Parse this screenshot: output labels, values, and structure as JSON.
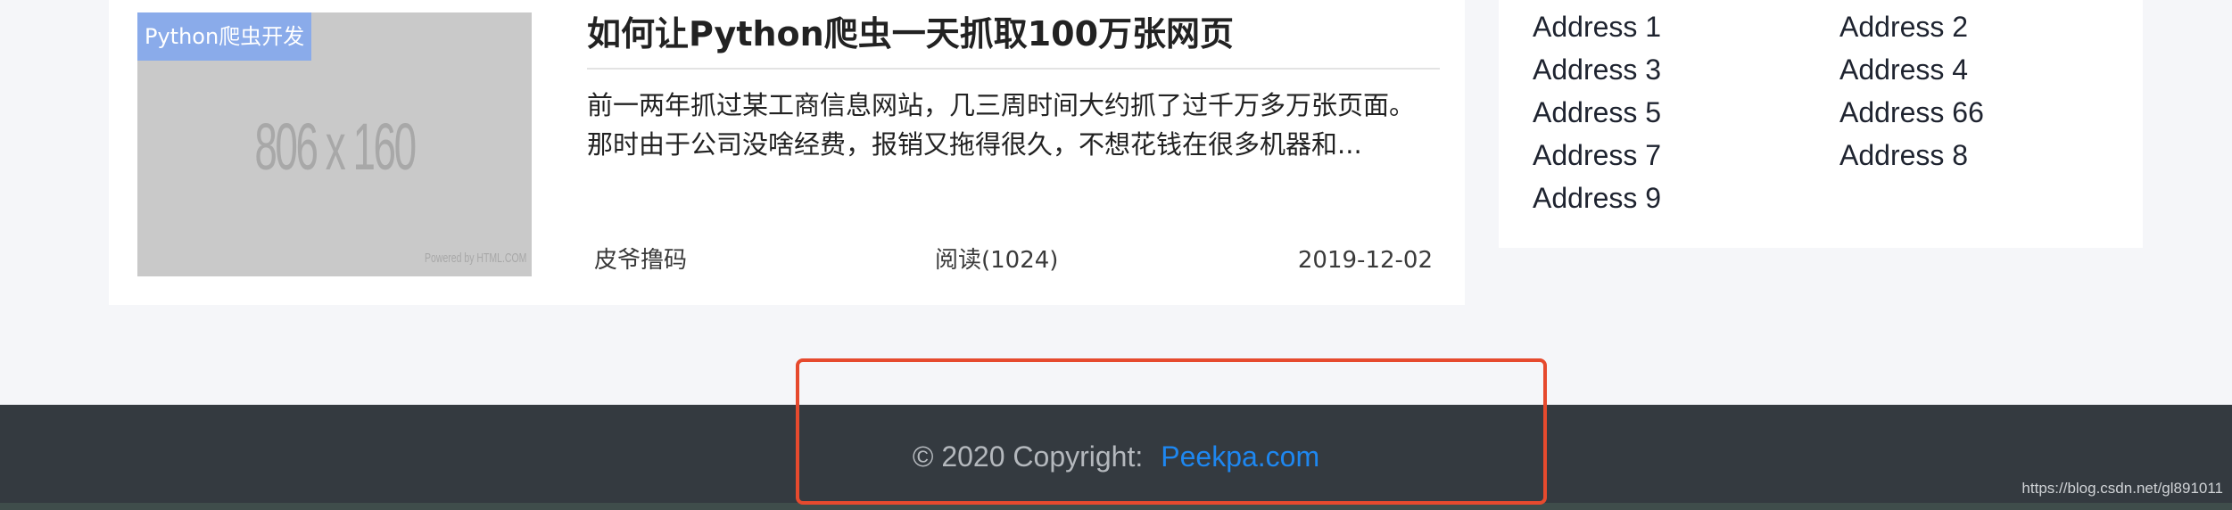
{
  "article": {
    "category_tag": "Python爬虫开发",
    "thumbnail": {
      "size_text": "806 x 160",
      "credit_text": "Powered by HTML.COM"
    },
    "title": "如何让Python爬虫一天抓取100万张网页",
    "excerpt": "前一两年抓过某工商信息网站，几三周时间大约抓了过千万多万张页面。那时由于公司没啥经费，报销又拖得很久，不想花钱在很多机器和...",
    "author": "皮爷撸码",
    "views": "阅读(1024)",
    "date": "2019-12-02"
  },
  "sidebar": {
    "addresses": [
      "Address 1",
      "Address 2",
      "Address 3",
      "Address 4",
      "Address 5",
      "Address 66",
      "Address 7",
      "Address 8",
      "Address 9"
    ]
  },
  "footer": {
    "copyright_text": "© 2020 Copyright:",
    "link_text": "Peekpa.com"
  },
  "watermark": "https://blog.csdn.net/gl891011",
  "colors": {
    "page_background": "#f5f6f9",
    "footer_background": "#343a40",
    "link": "#1e87f0",
    "tag_background": "#8aabea",
    "highlight_border": "#e64a2e"
  }
}
